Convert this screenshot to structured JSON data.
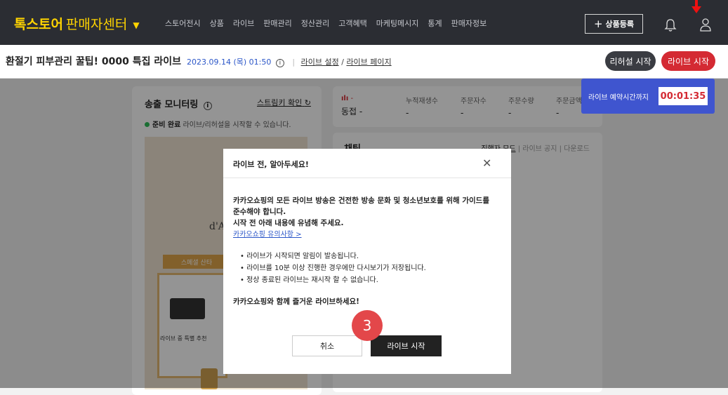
{
  "brand": {
    "name": "톡스토어",
    "sub": "판매자센터"
  },
  "nav": {
    "items": [
      "스토어전시",
      "상품",
      "라이브",
      "판매관리",
      "정산관리",
      "고객혜택",
      "마케팅메시지",
      "통계",
      "판매자정보"
    ]
  },
  "header": {
    "register_label": "상품등록"
  },
  "live": {
    "title": "환절기 피부관리 꿀팁! 0000 특집 라이브",
    "datetime": "2023.09.14 (목) 01:50",
    "settings_link": "라이브 설정",
    "page_link": "라이브 페이지",
    "slash": "/",
    "rehearsal_label": "리허설 시작",
    "start_label": "라이브 시작"
  },
  "monitor": {
    "title": "송출 모니터링",
    "stream_key": "스트림키 확인",
    "status": "준비 완료",
    "status_desc": "라이브/리허설을 시작할 수 있습니다.",
    "preview_brand": "d'A",
    "preview_promo": "스페셜 산타",
    "preview_text": "라이브 중 특별 추천"
  },
  "stats": {
    "signal": "-",
    "sync": "동접 -",
    "cols": [
      {
        "label": "누적재생수",
        "value": "-"
      },
      {
        "label": "주문자수",
        "value": "-"
      },
      {
        "label": "주문수량",
        "value": "-"
      },
      {
        "label": "주문금액",
        "value": "-"
      }
    ]
  },
  "chat": {
    "title": "채팅",
    "tab_host": "진행자 모드",
    "tab_notice": "라이브 공지",
    "tab_download": "다운로드"
  },
  "timer": {
    "label": "라이브 예약시간까지",
    "value": "00:01:35"
  },
  "modal": {
    "title": "라이브 전, 알아두세요!",
    "line1": "카카오쇼핑의 모든 라이브 방송은 건전한 방송 문화 및 청소년보호를 위해 가이드를",
    "line2": "준수해야 합니다.",
    "line3": "시작 전 아래 내용에 유념해 주세요.",
    "guide_link": "카카오쇼핑 유의사항 >",
    "bullets": [
      "라이브가 시작되면 알림이 발송됩니다.",
      "라이브를 10분 이상 진행한 경우에만 다시보기가 저장됩니다.",
      "정상 종료된 라이브는 재시작 할 수 없습니다."
    ],
    "enjoy": "카카오쇼핑와 함께 즐거운 라이브하세요!",
    "cancel_label": "취소",
    "start_label": "라이브 시작"
  },
  "step_badge": "3",
  "colors": {
    "nav_bg": "#2b2d33",
    "brand_yellow": "#ffd400",
    "primary_red": "#d42a33",
    "timer_blue": "#3f55cf"
  }
}
